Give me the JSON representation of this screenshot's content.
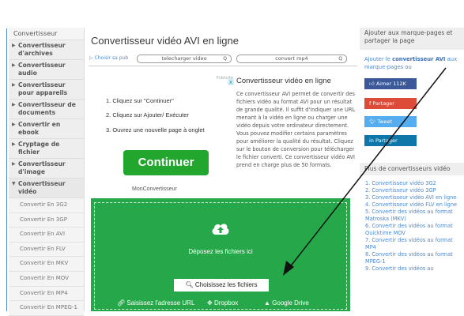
{
  "sidebar": {
    "header": "Convertisseur",
    "items": [
      {
        "label": "Convertisseur d'archives",
        "caret": "▶"
      },
      {
        "label": "Convertisseur audio",
        "caret": "▶"
      },
      {
        "label": "Convertisseur pour appareils",
        "caret": "▶"
      },
      {
        "label": "Convertisseur de documents",
        "caret": "▶"
      },
      {
        "label": "Convertir en ebook",
        "caret": "▶"
      },
      {
        "label": "Cryptage de fichier",
        "caret": "▶"
      },
      {
        "label": "Convertisseur d'image",
        "caret": "▶"
      },
      {
        "label": "Convertisseur vidéo",
        "caret": "▼"
      }
    ],
    "subitems": [
      "Convertir En 3G2",
      "Convertir En 3GP",
      "Convertir En AVI",
      "Convertir En FLV",
      "Convertir En MKV",
      "Convertir En MOV",
      "Convertir En MP4",
      "Convertir En MPEG-1"
    ]
  },
  "main": {
    "title": "Convertisseur vidéo AVI en ligne",
    "ad_choices": "Choisir sa pub",
    "search1": "telecharger video",
    "search2": "convert mp4",
    "ad": {
      "step1": "1. Cliquez sur \"Continuer\"",
      "step2": "2. Cliquez sur Ajouter/ Exécuter",
      "step3": "3. Ouvrez une nouvelle page à onglet",
      "cta": "Continuer",
      "brand": "MonConvertisseur",
      "close": "x",
      "mark": "Publicité"
    },
    "desc_title": "Convertisseur vidéo en ligne",
    "desc": "Ce convertisseur AVI permet de convertir des fichiers vidéo au format AVI pour un résultat de grande qualité. Il suffit d'indiquer une URL menant à la vidéo en ligne ou charger une vidéo depuis votre ordinateur directement. Vous pouvez modifier certains paramètres pour améliorer la qualité du résultat. Cliquez sur le bouton de conversion pour télécharger le fichier converti. Ce convertisseur vidéo AVI prend en charge plus de 50 formats.",
    "upload": {
      "drop_text": "Déposez les fichiers ici",
      "choose": "Choisissez les fichiers",
      "url": "Saisissez l'adresse URL",
      "dropbox": "Dropbox",
      "gdrive": "Google Drive"
    }
  },
  "right": {
    "bm_header": "Ajouter aux marque-pages et partager la page",
    "bm_pre": "Ajouter le",
    "bm_bold": "convertisseur AVI",
    "bm_post": "aux marque-pages ou",
    "like": "Aimer 112K",
    "share": "Partager",
    "tweet": "Tweet",
    "linkedin": "Partager",
    "more_header": "Plus de convertisseurs vidéo",
    "more": [
      "1. Convertisseur vidéo 3G2",
      "2. Convertisseur vidéo 3GP",
      "3. Convertisseur vidéo AVI en ligne",
      "4. Convertisseur vidéo FLV en ligne",
      "5. Convertir des vidéos au format Matroska (MKV)",
      "6. Convertir des vidéos au format Quicktime MOV",
      "7. Convertir des vidéos au format MP4",
      "8. Convertir des vidéos au format MPEG-1",
      "9. Convertir des vidéos au"
    ]
  },
  "colors": {
    "upload_bg": "#26a84a",
    "cta_bg": "#22a62e",
    "link": "#4a89d0",
    "facebook": "#3b5998",
    "google": "#dd4b39",
    "twitter": "#55acee",
    "linkedin": "#0e76a8"
  },
  "icons": [
    "upload-cloud-icon",
    "search-icon",
    "link-icon",
    "dropbox-icon",
    "google-drive-icon",
    "thumbs-up-icon",
    "facebook-icon",
    "twitter-icon",
    "linkedin-icon"
  ]
}
